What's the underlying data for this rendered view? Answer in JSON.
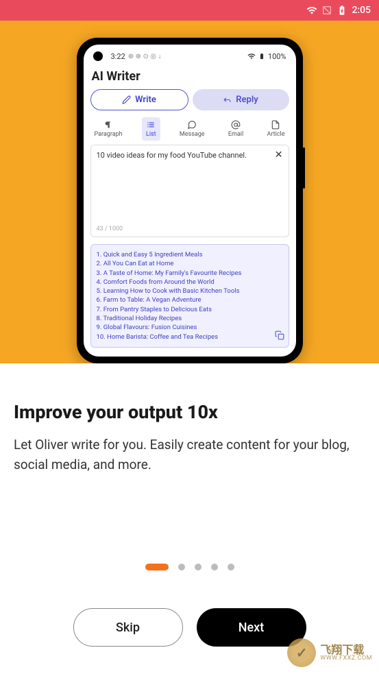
{
  "status_bar": {
    "time": "2:05"
  },
  "phone": {
    "status_time": "3:22",
    "battery": "100%",
    "app_title": "AI Writer",
    "tabs": {
      "write": "Write",
      "reply": "Reply"
    },
    "types": {
      "paragraph": "Paragraph",
      "list": "List",
      "message": "Message",
      "email": "Email",
      "article": "Article"
    },
    "input_text": "10 video ideas for my food YouTube channel.",
    "char_count": "43 / 1000",
    "output_items": [
      "1. Quick and Easy 5 Ingredient Meals",
      "2. All You Can Eat at Home",
      "3. A Taste of Home: My Family's Favourite Recipes",
      "4. Comfort Foods from Around the World",
      "5. Learning How to Cook with Basic Kitchen Tools",
      "6. Farm to Table: A Vegan Adventure",
      "7. From Pantry Staples to Delicious Eats",
      "8. Traditional Holiday Recipes",
      "9. Global Flavours: Fusion Cuisines",
      "10. Home Barista: Coffee and Tea Recipes"
    ]
  },
  "onboarding": {
    "headline": "Improve your output 10x",
    "subtext": "Let Oliver write for you. Easily create content for your blog, social media, and more.",
    "skip": "Skip",
    "next": "Next"
  },
  "watermark": {
    "main": "飞翔下载",
    "sub": "WWW.FXXZ.COM"
  }
}
